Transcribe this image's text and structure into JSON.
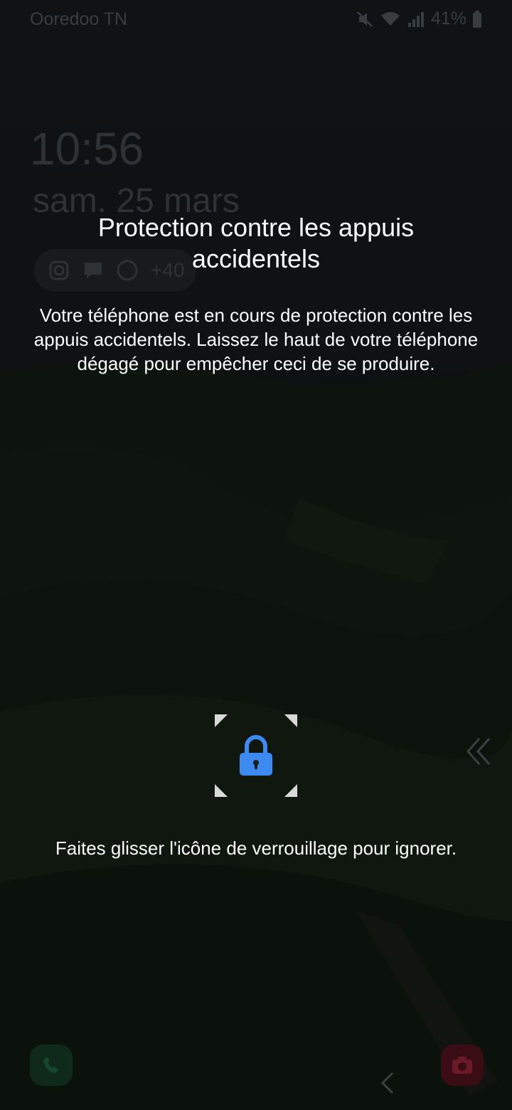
{
  "status_bar": {
    "carrier": "Ooredoo TN",
    "battery_percent": "41%"
  },
  "lockscreen": {
    "time": "10:56",
    "date": "sam. 25 mars",
    "notifications_more": "+40"
  },
  "overlay": {
    "title": "Protection contre les appuis accidentels",
    "description": "Votre téléphone est en cours de protection contre les appuis accidentels. Laissez le haut de votre téléphone dégagé pour empêcher ceci de se produire.",
    "hint": "Faites glisser l'icône de verrouillage pour ignorer.",
    "lock_icon": "lock-icon",
    "accent_color": "#3d8bf2"
  },
  "shortcuts": {
    "left_icon": "phone-icon",
    "right_icon": "camera-icon"
  }
}
